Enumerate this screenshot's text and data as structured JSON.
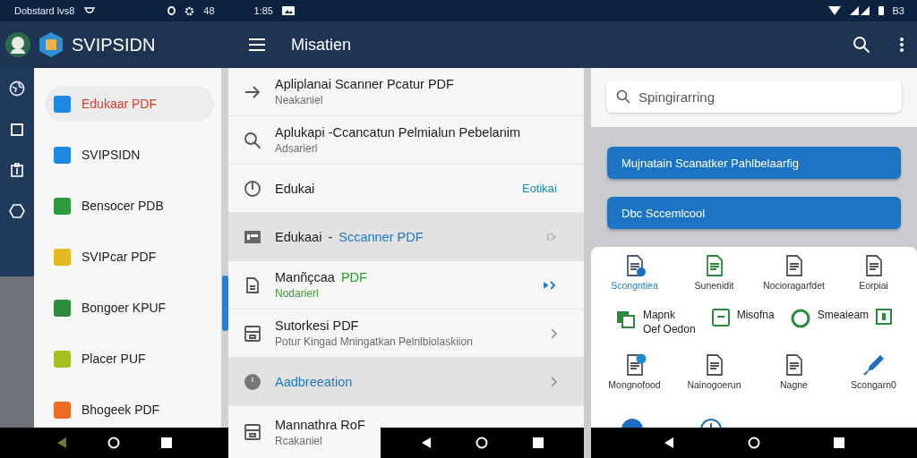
{
  "status_bar": {
    "left_text": "Dobstard lvs8",
    "center_text": "48",
    "time": "1:85",
    "right_text": "B3"
  },
  "app_bar": {
    "title": "SVIPSIDN",
    "section_title": "Misatien"
  },
  "drawer": {
    "items": [
      {
        "label": "Edukaar PDF",
        "color": "#1e88e5",
        "selected": true
      },
      {
        "label": "SVIPSIDN",
        "color": "#1e88e5",
        "selected": false
      },
      {
        "label": "Bensocer PDB",
        "color": "#2e9a3e",
        "selected": false
      },
      {
        "label": "SVIPcar PDF",
        "color": "#e6b820",
        "selected": false
      },
      {
        "label": "Bongoer KPUF",
        "color": "#2e8b3e",
        "selected": false
      },
      {
        "label": "Placer PUF",
        "color": "#a4c21f",
        "selected": false
      },
      {
        "label": "Bhogeek PDF",
        "color": "#ee6c25",
        "selected": false
      }
    ]
  },
  "list": {
    "items": [
      {
        "title": "Apliplanai Scanner Pcatur PDF",
        "subtitle": "Neakaniel",
        "selected": false
      },
      {
        "title": "Aplukapi -Ccancatun Pelmialun Pebelanim",
        "subtitle": "Adsarierl",
        "selected": false
      },
      {
        "title": "Edukai",
        "trailing_text": "Eotikai",
        "selected": false
      },
      {
        "title": "Edukaai",
        "separator": "-",
        "accent": "Sccanner PDF",
        "selected": true
      },
      {
        "title": "Manñçcaa",
        "accent": "PDF",
        "subtitle": "Nodarierl",
        "selected": false
      },
      {
        "title": "Sutorkesi PDF",
        "subtitle": "Potur Kingad Mningatkan Pelnlbiolaskiion",
        "selected": false
      },
      {
        "accent": "Aadbreeation",
        "selected": true
      },
      {
        "title": "Mannathra RoF",
        "subtitle": "Rcakaniel",
        "selected": false
      }
    ]
  },
  "panel": {
    "search": {
      "placeholder": "Spingirarring"
    },
    "buttons": [
      "Mujnatain Scanatker Pahlbelaarfig",
      "Dbc Sccemlcool"
    ],
    "tile_rows": [
      {
        "kind": "stack",
        "tiles": [
          {
            "label": "Scongntiea"
          },
          {
            "label": "Sunenidit"
          },
          {
            "label": "Nocioragarfdet"
          },
          {
            "label": "Eorpiai"
          }
        ]
      },
      {
        "kind": "inline",
        "tiles": [
          {
            "label": "Mapnk",
            "sublabel": "Oef Oedon"
          },
          {
            "label": "Misofna"
          },
          {
            "label": "Smeaieam"
          }
        ]
      },
      {
        "kind": "stack",
        "tiles": [
          {
            "label": "Mongnofood"
          },
          {
            "label": "Nainogoerun"
          },
          {
            "label": "Nagne"
          },
          {
            "label": "Scongarn0"
          }
        ]
      }
    ]
  }
}
